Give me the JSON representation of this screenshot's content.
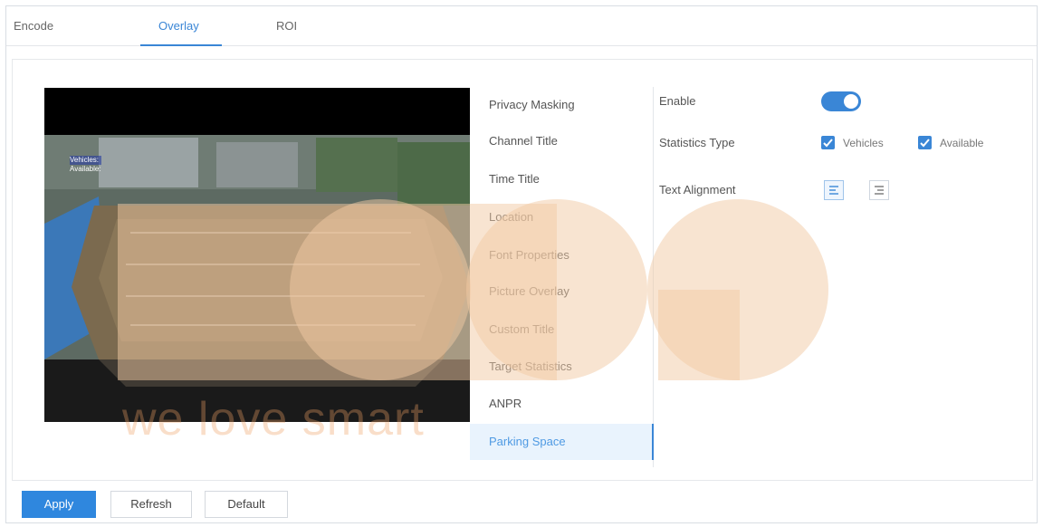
{
  "tabs": [
    {
      "label": "Encode"
    },
    {
      "label": "Overlay"
    },
    {
      "label": "ROI"
    }
  ],
  "video": {
    "overlay_lines": [
      "Vehicles: ",
      "Available: "
    ]
  },
  "menu": {
    "items": [
      {
        "label": "Privacy Masking"
      },
      {
        "label": "Channel Title"
      },
      {
        "label": "Time Title"
      },
      {
        "label": "Location"
      },
      {
        "label": "Font Properties"
      },
      {
        "label": "Picture Overlay"
      },
      {
        "label": "Custom Title"
      },
      {
        "label": "Target Statistics"
      },
      {
        "label": "ANPR"
      },
      {
        "label": "Parking Space"
      }
    ],
    "selected": "Parking Space"
  },
  "form": {
    "enable_label": "Enable",
    "enable_on": true,
    "statistics_type_label": "Statistics Type",
    "vehicles_label": "Vehicles",
    "available_label": "Available",
    "text_alignment_label": "Text Alignment"
  },
  "footer": {
    "apply": "Apply",
    "refresh": "Refresh",
    "default": "Default"
  },
  "watermark": {
    "text": "we love smart"
  },
  "colors": {
    "accent": "#3a86d6",
    "watermark": "#f2c9a3"
  }
}
